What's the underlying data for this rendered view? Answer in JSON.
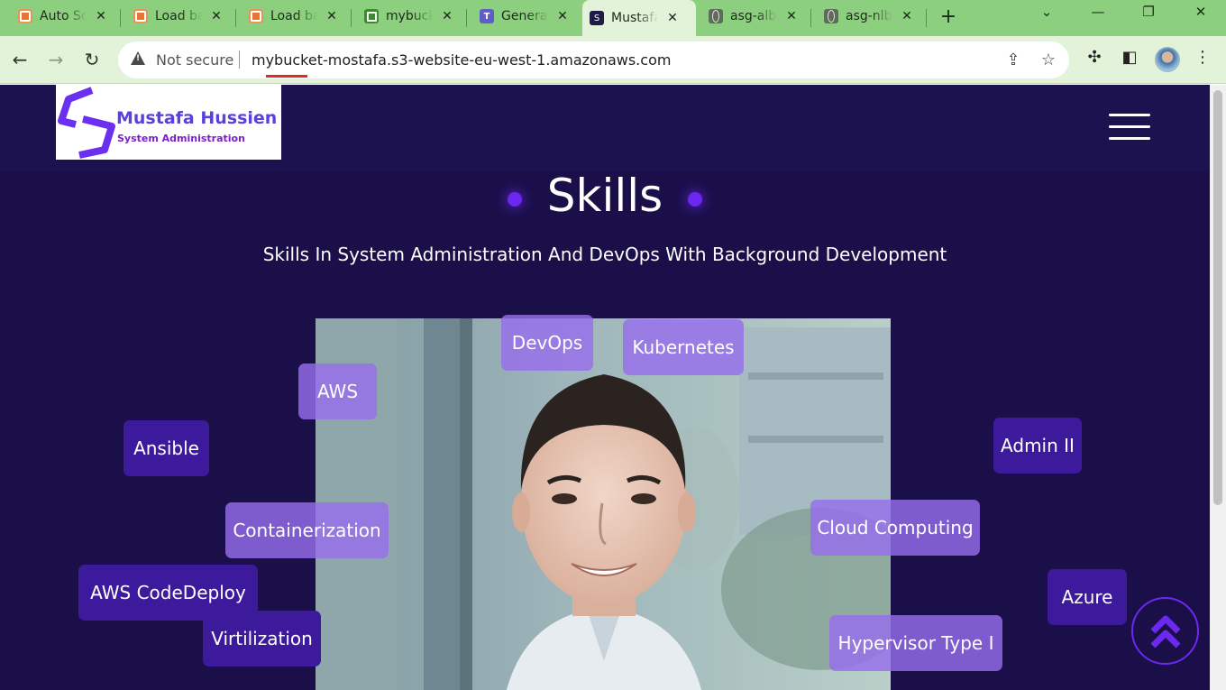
{
  "browser": {
    "tabs": [
      {
        "title": "Auto Scaling groups",
        "icon": "aws-icon"
      },
      {
        "title": "Load balancers",
        "icon": "aws-icon"
      },
      {
        "title": "Load balancers",
        "icon": "aws-icon"
      },
      {
        "title": "mybucket-mostafa",
        "icon": "s3-icon"
      },
      {
        "title": "General",
        "icon": "teams-icon"
      },
      {
        "title": "Mustafa Hussien",
        "icon": "site-icon",
        "active": true
      },
      {
        "title": "asg-alb",
        "icon": "globe-icon"
      },
      {
        "title": "asg-nlb",
        "icon": "globe-icon"
      }
    ],
    "close_glyph": "✕",
    "new_tab_glyph": "+",
    "security_label": "Not secure",
    "url": "mybucket-mostafa.s3-website-eu-west-1.amazonaws.com"
  },
  "site": {
    "logo_name": "Mustafa Hussien",
    "logo_subtitle": "System Administration",
    "section_title": "Skills",
    "section_subtitle": "Skills In System Administration And DevOps With Background Development",
    "skills": [
      {
        "label": "DevOps",
        "style": "light"
      },
      {
        "label": "Kubernetes",
        "style": "light"
      },
      {
        "label": "AWS",
        "style": "light"
      },
      {
        "label": "Ansible",
        "style": "dark"
      },
      {
        "label": "Admin II",
        "style": "dark"
      },
      {
        "label": "Containerization",
        "style": "light"
      },
      {
        "label": "Cloud Computing",
        "style": "light"
      },
      {
        "label": "AWS CodeDeploy",
        "style": "dark"
      },
      {
        "label": "Azure",
        "style": "dark"
      },
      {
        "label": "Virtilization",
        "style": "dark"
      },
      {
        "label": "Hypervisor Type I",
        "style": "light"
      }
    ],
    "colors": {
      "background": "#1b0f4a",
      "accent": "#6d28f0",
      "chip_dark": "#3d1a9c",
      "chip_light": "#966eeb"
    }
  }
}
